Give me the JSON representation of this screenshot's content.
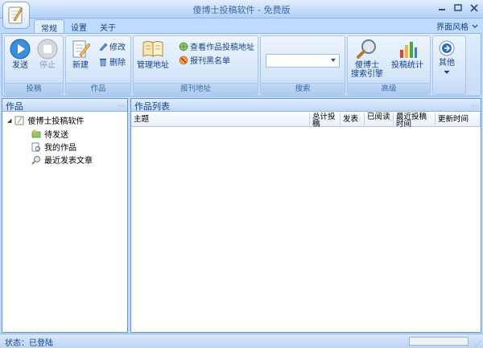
{
  "window": {
    "title": "傻博士投稿软件 - 免费版"
  },
  "tabs": [
    {
      "label": "常规",
      "active": true
    },
    {
      "label": "设置",
      "active": false
    },
    {
      "label": "关于",
      "active": false
    }
  ],
  "skin_menu": {
    "label": "界面风格"
  },
  "ribbon": {
    "group_submit": {
      "label": "投稿",
      "send": "发送",
      "stop": "停止"
    },
    "group_works": {
      "label": "作品",
      "new": "新建",
      "edit": "修改",
      "delete": "删除"
    },
    "group_address": {
      "label": "报刊地址",
      "manage": "管理地址",
      "view": "查看作品投稿地址",
      "blacklist": "报刊黑名单"
    },
    "group_search": {
      "label": "搜索",
      "value": ""
    },
    "group_advanced": {
      "label": "高级",
      "engine_line1": "傻博士",
      "engine_line2": "搜索引擎",
      "stats": "投稿统计"
    },
    "group_other": {
      "label": "其他"
    }
  },
  "left_pane": {
    "title": "作品",
    "root": "傻博士投稿软件",
    "children": [
      "待发送",
      "我的作品",
      "最近发表文章"
    ]
  },
  "right_pane": {
    "title": "作品列表",
    "columns": [
      "主题",
      "总计投稿",
      "发表",
      "已阅读",
      "最近投稿时间",
      "更新时间"
    ]
  },
  "status": {
    "text": "状态：已登陆"
  },
  "colors": {
    "accent": "#15428b",
    "ribbon_bg": "#dfecfc",
    "frame": "#bfdbff"
  }
}
